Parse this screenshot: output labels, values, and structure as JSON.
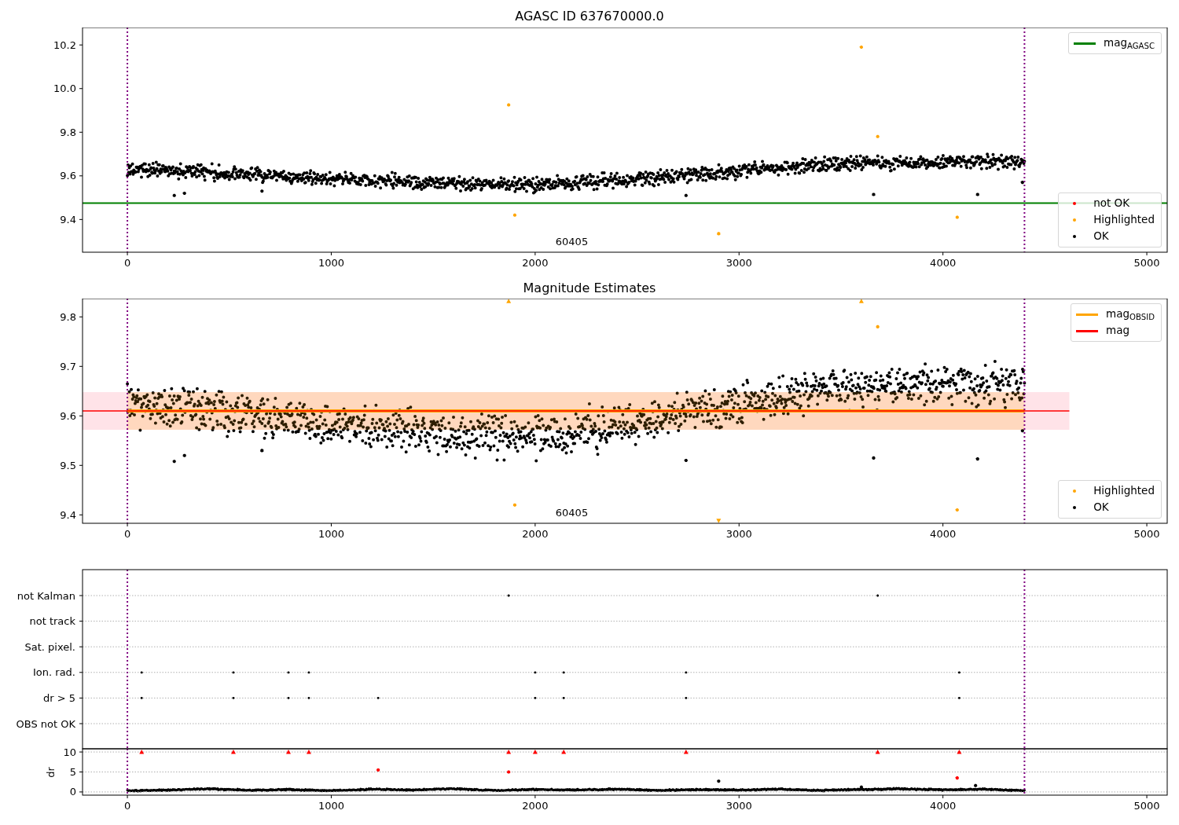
{
  "figure": {
    "panels": [
      {
        "legends": [
          {
            "entries": [
              {
                "label": "mag$_{AGASC}$",
                "color": "#008000",
                "kind": "line"
              }
            ]
          },
          {
            "entries": [
              {
                "label": "not OK",
                "color": "#ff0000",
                "kind": "dot"
              },
              {
                "label": "Highlighted",
                "color": "#ffa500",
                "kind": "dot"
              },
              {
                "label": "OK",
                "color": "#000000",
                "kind": "dot"
              }
            ]
          }
        ],
        "chart_data": {
          "type": "scatter",
          "title": "AGASC ID 637670000.0",
          "xlim": [
            -220,
            5100
          ],
          "ylim": [
            9.25,
            10.28
          ],
          "xticks": [
            0,
            1000,
            2000,
            3000,
            4000,
            5000
          ],
          "yticks": [
            {
              "value": 9.4,
              "label": "9.4"
            },
            {
              "value": 9.6,
              "label": "9.6"
            },
            {
              "value": 9.8,
              "label": "9.8"
            },
            {
              "value": 10.0,
              "label": "10.0"
            },
            {
              "value": 10.2,
              "label": "10.2"
            }
          ],
          "series": [
            {
              "color": "#000000",
              "x": [
                230,
                280,
                660,
                2740,
                3660,
                4170,
                4390
              ],
              "values": [
                9.51,
                9.52,
                9.53,
                9.51,
                9.515,
                9.515,
                9.57
              ]
            },
            {
              "color": "#ffa500",
              "x": [
                1870,
                1900,
                2900,
                3600,
                3680,
                4070
              ],
              "values": [
                9.925,
                9.42,
                9.335,
                10.19,
                9.78,
                9.41
              ]
            }
          ],
          "ref_lines": [
            {
              "axis": "y",
              "value": 9.475,
              "color": "#008000"
            },
            {
              "axis": "x",
              "value": 0,
              "color": "#800080"
            },
            {
              "axis": "x",
              "value": 4400,
              "color": "#800080"
            }
          ],
          "annotations": [
            "60405"
          ]
        }
      },
      {
        "legends": [
          {
            "entries": [
              {
                "label": "mag$_{OBSID}$",
                "color": "#ffa500",
                "kind": "line"
              },
              {
                "label": "mag",
                "color": "#ff0000",
                "kind": "line"
              }
            ]
          },
          {
            "entries": [
              {
                "label": "Highlighted",
                "color": "#ffa500",
                "kind": "dot"
              },
              {
                "label": "OK",
                "color": "#000000",
                "kind": "dot"
              }
            ]
          }
        ],
        "chart_data": {
          "type": "scatter",
          "title": "Magnitude Estimates",
          "xlim": [
            -220,
            5100
          ],
          "ylim": [
            9.383,
            9.837
          ],
          "xticks": [
            0,
            1000,
            2000,
            3000,
            4000,
            5000
          ],
          "yticks": [
            {
              "value": 9.4,
              "label": "9.4"
            },
            {
              "value": 9.5,
              "label": "9.5"
            },
            {
              "value": 9.6,
              "label": "9.6"
            },
            {
              "value": 9.7,
              "label": "9.7"
            },
            {
              "value": 9.8,
              "label": "9.8"
            }
          ],
          "series": [
            {
              "color": "#000000",
              "x": [
                230,
                280,
                660,
                2740,
                3660,
                4170,
                4390
              ],
              "values": [
                9.508,
                9.52,
                9.53,
                9.51,
                9.515,
                9.513,
                9.57
              ]
            },
            {
              "color": "#ffa500",
              "x": [
                1870,
                1900,
                2900,
                3600,
                3680,
                4070
              ],
              "values": [
                9.832,
                9.42,
                9.388,
                9.832,
                9.78,
                9.41
              ]
            }
          ],
          "bands": [
            {
              "axis": "y",
              "from": 9.572,
              "to": 9.648,
              "color": "#ffc0cb"
            },
            {
              "axis": "y",
              "from": 9.572,
              "to": 9.648,
              "color": "#ffa500"
            }
          ],
          "ref_lines": [
            {
              "axis": "y",
              "value": 9.61,
              "color": "#ffa500"
            },
            {
              "axis": "y",
              "value": 9.61,
              "color": "#ff0000"
            },
            {
              "axis": "x",
              "value": 0,
              "color": "#800080"
            },
            {
              "axis": "x",
              "value": 4400,
              "color": "#800080"
            }
          ],
          "annotations": [
            "60405"
          ]
        }
      },
      {
        "flags": {
          "chart_data": {
            "type": "scatter",
            "orientation": "horizontal",
            "categories": [
              "not Kalman",
              "not track",
              "Sat. pixel.",
              "Ion. rad.",
              "dr > 5",
              "OBS not OK"
            ],
            "xlim": [
              -220,
              5100
            ],
            "grid": true,
            "series": [
              {
                "color": "#000000",
                "values": [
                  1870,
                  null,
                  null,
                  70,
                  70,
                  null
                ]
              },
              {
                "color": "#000000",
                "values": [
                  3680,
                  null,
                  null,
                  520,
                  520,
                  null
                ]
              },
              {
                "color": "#000000",
                "values": [
                  null,
                  null,
                  null,
                  790,
                  790,
                  null
                ]
              },
              {
                "color": "#000000",
                "values": [
                  null,
                  null,
                  null,
                  890,
                  890,
                  null
                ]
              },
              {
                "color": "#000000",
                "values": [
                  null,
                  null,
                  null,
                  2000,
                  1230,
                  null
                ]
              },
              {
                "color": "#000000",
                "values": [
                  null,
                  null,
                  null,
                  2140,
                  2000,
                  null
                ]
              },
              {
                "color": "#000000",
                "values": [
                  null,
                  null,
                  null,
                  2740,
                  2140,
                  null
                ]
              },
              {
                "color": "#000000",
                "values": [
                  null,
                  null,
                  null,
                  4080,
                  2740,
                  null
                ]
              },
              {
                "color": "#000000",
                "values": [
                  null,
                  null,
                  null,
                  null,
                  4080,
                  null
                ]
              }
            ],
            "ref_lines": [
              {
                "axis": "x",
                "value": 0,
                "color": "#800080"
              },
              {
                "axis": "x",
                "value": 4400,
                "color": "#800080"
              }
            ]
          }
        },
        "dr": {
          "chart_data": {
            "type": "scatter",
            "ylabel": "dr",
            "xlim": [
              -220,
              5100
            ],
            "ylim": [
              -0.8,
              10.8
            ],
            "xticks": [
              0,
              1000,
              2000,
              3000,
              4000,
              5000
            ],
            "yticks": [
              0,
              5,
              10
            ],
            "grid": true,
            "series": [
              {
                "color": "#ff0000",
                "x": [
                  70,
                  520,
                  790,
                  890,
                  1870,
                  2000,
                  2140,
                  2740,
                  3680,
                  4080,
                  1230,
                  1870,
                  4070
                ],
                "values": [
                  10,
                  10,
                  10,
                  10,
                  10,
                  10,
                  10,
                  10,
                  10,
                  10,
                  5.5,
                  5,
                  3.5
                ]
              },
              {
                "color": "#000000",
                "x": [
                  2900,
                  4160,
                  3600
                ],
                "values": [
                  2.7,
                  1.6,
                  1.2
                ]
              }
            ],
            "ref_lines": [
              {
                "axis": "x",
                "value": 0,
                "color": "#800080"
              },
              {
                "axis": "x",
                "value": 4400,
                "color": "#800080"
              }
            ]
          }
        }
      }
    ]
  }
}
